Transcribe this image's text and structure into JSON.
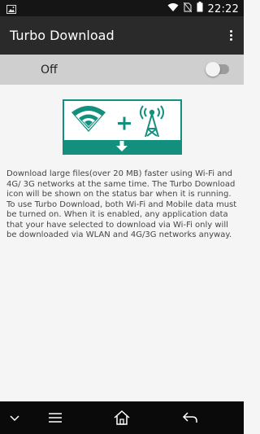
{
  "status_bar": {
    "time": "22:22",
    "icons": [
      "image-icon",
      "wifi-icon",
      "no-sim-icon",
      "battery-icon"
    ]
  },
  "app_bar": {
    "title": "Turbo Download",
    "menu_icon": "more-vert-icon"
  },
  "toggle": {
    "label": "Off",
    "state": "off"
  },
  "illustration": {
    "icons": [
      "wifi-icon",
      "plus-icon",
      "cell-tower-icon",
      "download-arrow-icon"
    ],
    "accent_color": "#12907d"
  },
  "description": "Download large files(over 20 MB) faster using Wi-Fi and 4G/ 3G networks at the same time. The Turbo Download icon will be shown on the status bar when it is running. To use Turbo Download, both Wi-Fi and Mobile data must be turned on. When it is enabled, any application data that your have selected to download via Wi-Fi only will be downloaded via WLAN and 4G/3G networks anyway.",
  "nav_bar": {
    "buttons": [
      "chevron-down-icon",
      "menu-icon",
      "home-icon",
      "back-icon"
    ]
  }
}
